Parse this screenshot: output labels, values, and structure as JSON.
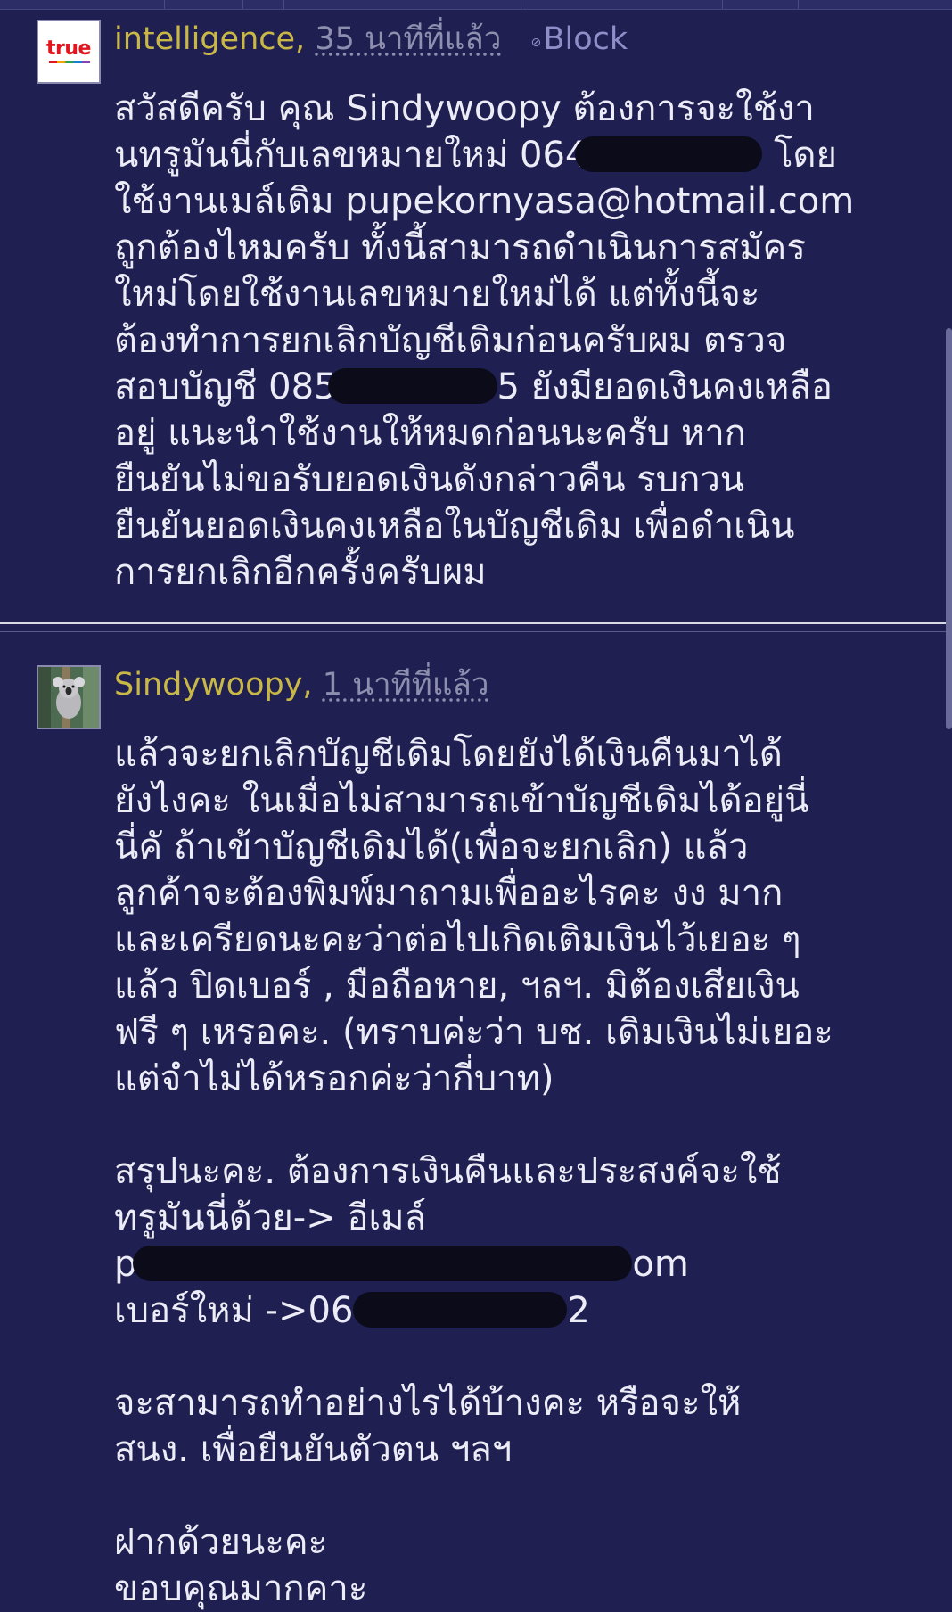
{
  "comment1": {
    "username": "intelligence,",
    "timestamp": "35 นาทีที่แล้ว",
    "block_label": "Block",
    "avatar_logo": "true",
    "lines": [
      [
        "สวัสดีครับ คุณ Sindywoopy ต้องการจะใช้งา",
        "",
        ""
      ],
      [
        "นทรูมันนี่กับเลขหมายใหม่ 064",
        "",
        " โดย"
      ],
      [
        "ใช้งานเมล์เดิม pupekornyasa@hotmail.com",
        "",
        ""
      ],
      [
        "ถูกต้องไหมครับ ทั้งนี้สามารถดำเนินการสมัคร",
        "",
        ""
      ],
      [
        "ใหม่โดยใช้งานเลขหมายใหม่ได้ แต่ทั้งนี้จะ",
        "",
        ""
      ],
      [
        "ต้องทำการยกเลิกบัญชีเดิมก่อนครับผม ตรวจ",
        "",
        ""
      ],
      [
        "สอบบัญชี 085",
        "",
        "5 ยังมียอดเงินคงเหลือ"
      ],
      [
        "อยู่ แนะนำใช้งานให้หมดก่อนนะครับ หาก",
        "",
        ""
      ],
      [
        "ยืนยันไม่ขอรับยอดเงินดังกล่าวคืน รบกวน",
        "",
        ""
      ],
      [
        "ยืนยันยอดเงินคงเหลือในบัญชีเดิม เพื่อดำเนิน",
        "",
        ""
      ],
      [
        "การยกเลิกอีกครั้งครับผม",
        "",
        ""
      ]
    ]
  },
  "comment2": {
    "username": "Sindywoopy,",
    "timestamp": "1 นาทีที่แล้ว",
    "lines": [
      [
        "แล้วจะยกเลิกบัญชีเดิมโดยยังได้เงินคืนมาได้",
        "",
        ""
      ],
      [
        "ยังไงคะ ในเมื่อไม่สามารถเข้าบัญชีเดิมได้อยู่นี่",
        "",
        ""
      ],
      [
        "นี่คั ถ้าเข้าบัญชีเดิมได้(เพื่อจะยกเลิก) แล้ว",
        "",
        ""
      ],
      [
        "ลูกค้าจะต้องพิมพ์มาถามเพื่ออะไรคะ งง มาก",
        "",
        ""
      ],
      [
        "และเครียดนะคะว่าต่อไปเกิดเติมเงินไว้เยอะ ๆ",
        "",
        ""
      ],
      [
        "แล้ว ปิดเบอร์ , มือถือหาย, ฯลฯ. มิต้องเสียเงิน",
        "",
        ""
      ],
      [
        "ฟรี ๆ เหรอคะ. (ทราบค่ะว่า บช. เดิมเงินไม่เยอะ",
        "",
        ""
      ],
      [
        "แต่จำไม่ได้หรอกค่ะว่ากี่บาท)",
        "",
        ""
      ],
      [
        "",
        "",
        ""
      ],
      [
        "สรุปนะคะ. ต้องการเงินคืนและประสงค์จะใช้",
        "",
        ""
      ],
      [
        "ทรูมันนี่ด้วย-> อีเมล์",
        "",
        ""
      ],
      [
        "p",
        "",
        "om"
      ],
      [
        "เบอร์ใหม่ ->06",
        "",
        "2"
      ],
      [
        "",
        "",
        ""
      ],
      [
        "จะสามารถทำอย่างไรได้บ้างคะ หรือจะให้",
        "",
        ""
      ],
      [
        "สนง. เพื่อยืนยันตัวตน ฯลฯ",
        "",
        ""
      ],
      [
        "",
        "",
        ""
      ],
      [
        "ฝากด้วยนะคะ",
        "",
        ""
      ],
      [
        "ขอบคุณมากคาะ",
        "",
        ""
      ]
    ]
  },
  "icons": {
    "block": "block-icon",
    "koala_avatar": "koala-avatar-icon"
  }
}
